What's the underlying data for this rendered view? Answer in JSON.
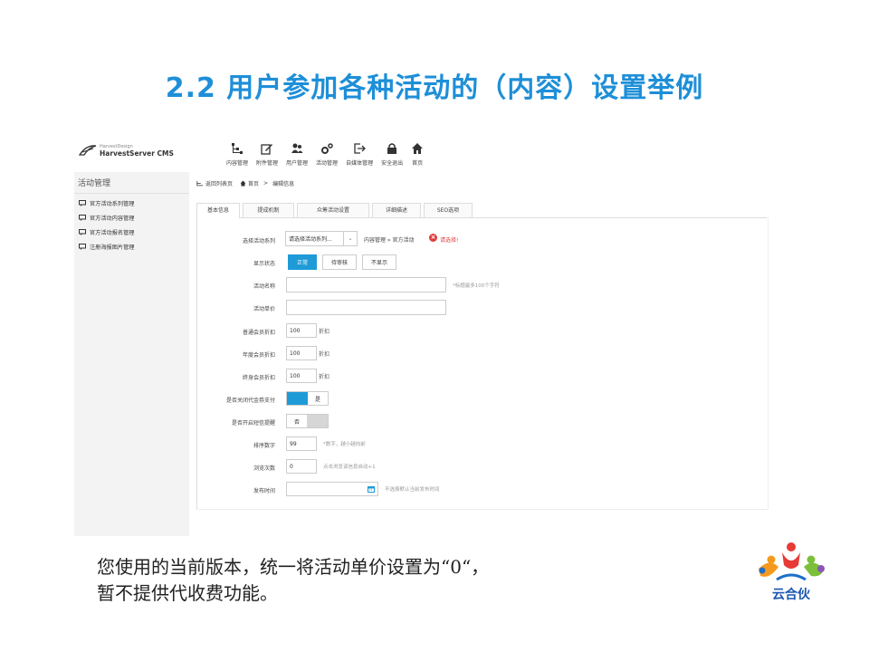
{
  "slide": {
    "title": "2.2 用户参加各种活动的（内容）设置举例",
    "note_line1": "您使用的当前版本，统一将活动单价设置为“0“，",
    "note_line2": "暂不提供代收费功能。",
    "brand_logo_text": "云合伙"
  },
  "cms": {
    "logo_small": "HarvestDesign",
    "logo_big": "HarvestServer CMS",
    "nav": [
      {
        "label": "内容管理",
        "icon": "content-tree-icon"
      },
      {
        "label": "附件管理",
        "icon": "edit-icon"
      },
      {
        "label": "用户管理",
        "icon": "users-icon"
      },
      {
        "label": "活动管理",
        "icon": "gears-icon"
      },
      {
        "label": "自媒体管理",
        "icon": "export-icon"
      },
      {
        "label": "安全退出",
        "icon": "lock-icon"
      },
      {
        "label": "首页",
        "icon": "home-icon"
      }
    ],
    "sidebar": {
      "title": "活动管理",
      "items": [
        "官方活动系列管理",
        "官方活动内容管理",
        "官方活动报名管理",
        "注册海报图片管理"
      ]
    },
    "breadcrumb": {
      "back": "返回列表页",
      "home": "首页",
      "sep": ">",
      "current": "编辑信息"
    },
    "tabs": [
      "基本信息",
      "提成机制",
      "众筹活动设置",
      "详细描述",
      "SEO选项"
    ],
    "form": {
      "series": {
        "label": "选择活动系列",
        "value": "请选择活动系列...",
        "path": "内容管理 » 官方活动",
        "error": "请选择!"
      },
      "status": {
        "label": "显示状态",
        "options": [
          "正常",
          "待审核",
          "不显示"
        ],
        "selected": "正常"
      },
      "name": {
        "label": "活动名称",
        "value": "",
        "hint": "*标题最多100个字符"
      },
      "price": {
        "label": "活动单价",
        "value": ""
      },
      "discount_normal": {
        "label": "普通会员折扣",
        "value": "100",
        "suffix": "折扣"
      },
      "discount_year": {
        "label": "年度会员折扣",
        "value": "100",
        "suffix": "折扣"
      },
      "discount_life": {
        "label": "终身会员折扣",
        "value": "100",
        "suffix": "折扣"
      },
      "close_agent_pay": {
        "label": "是否关闭代金券支付",
        "value": "是",
        "on": true
      },
      "sms_remind": {
        "label": "是否开启短信提醒",
        "value": "否",
        "on": false
      },
      "sort": {
        "label": "排序数字",
        "value": "99",
        "hint": "*数字，越小越向前"
      },
      "views": {
        "label": "浏览次数",
        "value": "0",
        "hint": "点击浏览该信息自动+1"
      },
      "publish_time": {
        "label": "发布时间",
        "value": "",
        "hint": "不选择默认当前发布时间"
      }
    }
  },
  "colors": {
    "title": "#1e8fd8",
    "primary": "#1e9bd7",
    "error": "#e03c3c"
  }
}
